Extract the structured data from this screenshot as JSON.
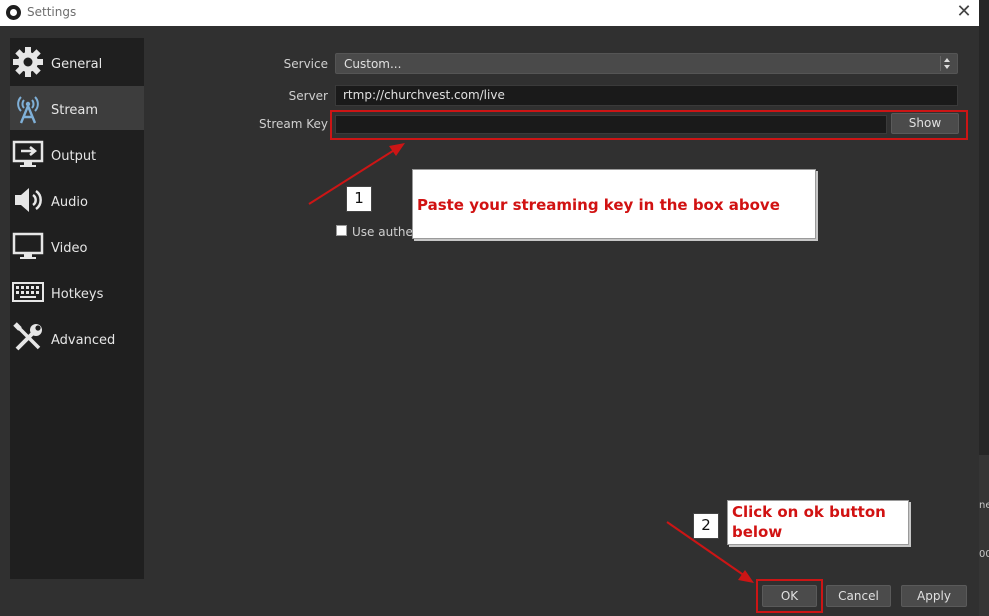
{
  "window": {
    "title": "Settings",
    "close_glyph": "✕"
  },
  "sidebar": {
    "items": [
      {
        "label": "General",
        "icon": "gear-icon",
        "active": false
      },
      {
        "label": "Stream",
        "icon": "antenna-icon",
        "active": true
      },
      {
        "label": "Output",
        "icon": "output-icon",
        "active": false
      },
      {
        "label": "Audio",
        "icon": "speaker-icon",
        "active": false
      },
      {
        "label": "Video",
        "icon": "monitor-icon",
        "active": false
      },
      {
        "label": "Hotkeys",
        "icon": "keyboard-icon",
        "active": false
      },
      {
        "label": "Advanced",
        "icon": "tools-icon",
        "active": false
      }
    ]
  },
  "stream": {
    "service_label": "Service",
    "service_value": "Custom...",
    "server_label": "Server",
    "server_value": "rtmp://churchvest.com/live",
    "stream_key_label": "Stream Key",
    "stream_key_value": "",
    "show_button": "Show",
    "use_auth_label": "Use authent"
  },
  "annotations": {
    "step1_number": "1",
    "step1_text": "Paste your streaming key in the box above",
    "step2_number": "2",
    "step2_text": "Click on ok button below",
    "color": "#cc1515"
  },
  "footer": {
    "ok": "OK",
    "cancel": "Cancel",
    "apply": "Apply"
  },
  "background_fragments": {
    "a": "ne",
    "b": "00"
  }
}
